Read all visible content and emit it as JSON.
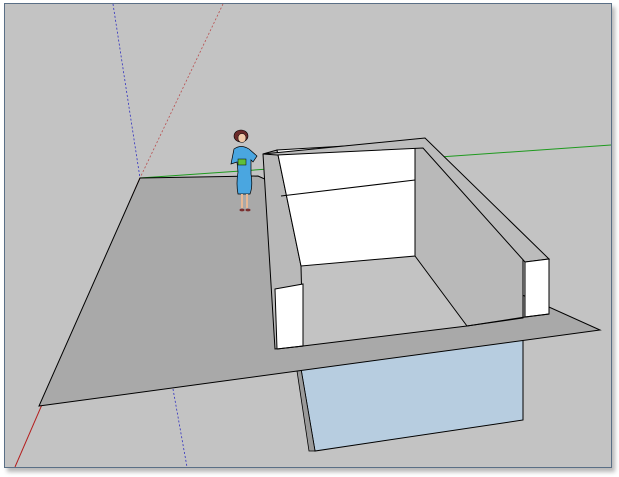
{
  "viewport": {
    "background_color": "#c3c3c3",
    "axis_colors": {
      "red": "#b41e1e",
      "green": "#1e9a1e",
      "blue": "#3030c0"
    },
    "ground_color": "#a9a9a9",
    "wall_face_color": "#ffffff",
    "wall_top_color": "#bcbcbc",
    "inner_side_wall_color": "#b9b9b9",
    "below_ground_wall_color": "#b7cde0",
    "edge_color": "#000000"
  },
  "scale_figure": {
    "icon": "person-figure-icon",
    "dress_color": "#4aa6e0"
  }
}
